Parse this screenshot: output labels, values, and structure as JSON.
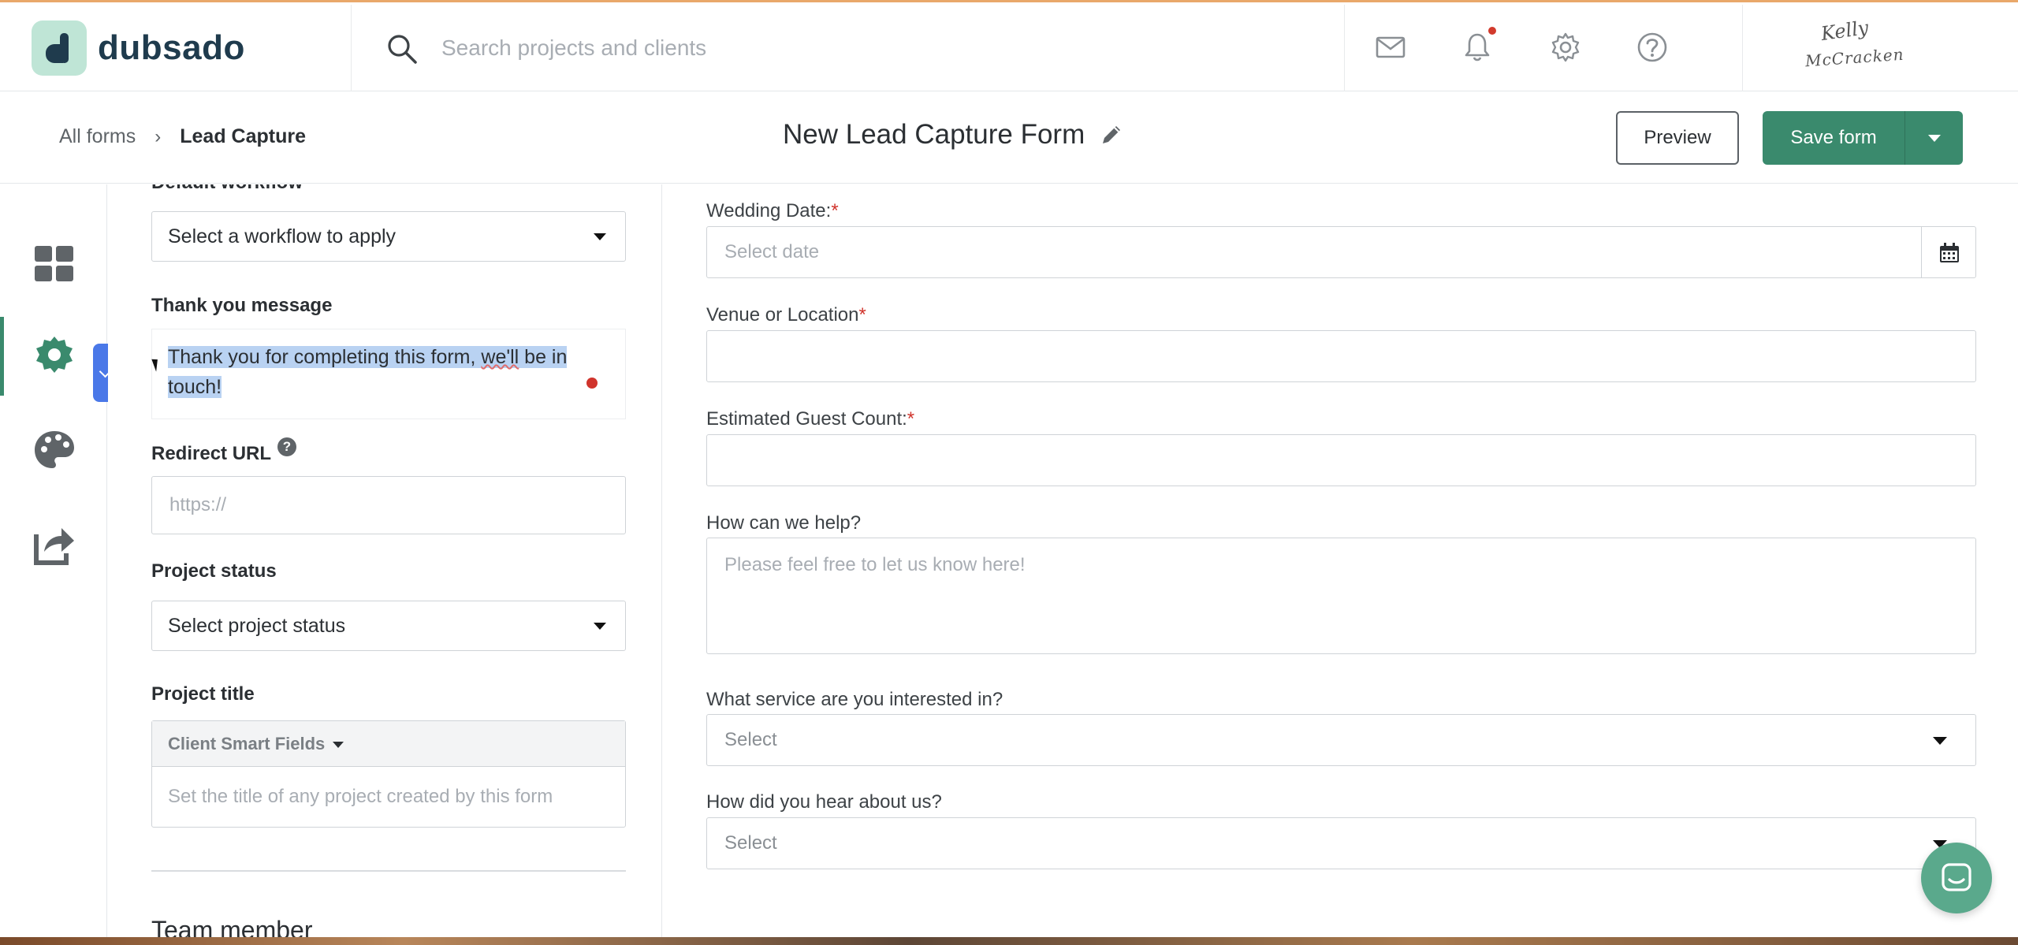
{
  "app": {
    "name": "dubsado",
    "search_placeholder": "Search projects and clients",
    "user_signature": [
      "Kelly",
      "McCracken"
    ]
  },
  "header": {
    "breadcrumb": {
      "parent": "All forms",
      "separator": "›",
      "current": "Lead Capture"
    },
    "form_title": "New Lead Capture Form",
    "preview_label": "Preview",
    "save_label": "Save form"
  },
  "settings": {
    "default_workflow_label": "Default workflow",
    "workflow_select": "Select a workflow to apply",
    "thank_you_label": "Thank you message",
    "thank_you_text_a": "Thank you for completing this form, ",
    "thank_you_text_b": "we'll",
    "thank_you_text_c": " be in touch!",
    "redirect_label": "Redirect URL",
    "redirect_help": "?",
    "redirect_placeholder": "https://",
    "project_status_label": "Project status",
    "project_status_select": "Select project status",
    "project_title_label": "Project title",
    "smart_fields_label": "Client Smart Fields",
    "project_title_placeholder": "Set the title of any project created by this form",
    "team_member_label": "Team member"
  },
  "form": {
    "wedding_date_label": "Wedding Date:",
    "wedding_date_placeholder": "Select date",
    "venue_label": "Venue or Location",
    "guest_count_label": "Estimated Guest Count:",
    "help_label": "How can we help?",
    "help_placeholder": "Please feel free to let us know here!",
    "service_label": "What service are you interested in?",
    "service_select": "Select",
    "hear_label": "How did you hear about us?",
    "hear_select": "Select",
    "required_mark": "*"
  },
  "colors": {
    "brand_green": "#3a8a6d",
    "logo_mint": "#bfe5d6",
    "logo_navy": "#1f3b4d",
    "collapse_blue": "#4a78e8",
    "required_red": "#d0342c",
    "highlight": "#b9d2f2"
  },
  "icons": {
    "top": [
      "search-icon",
      "mail-icon",
      "bell-icon",
      "gear-icon",
      "help-icon"
    ],
    "rail": [
      "dashboard-grid-icon",
      "settings-gear-icon",
      "palette-icon",
      "share-icon"
    ],
    "misc": [
      "pencil-icon",
      "calendar-icon",
      "chat-icon"
    ]
  }
}
